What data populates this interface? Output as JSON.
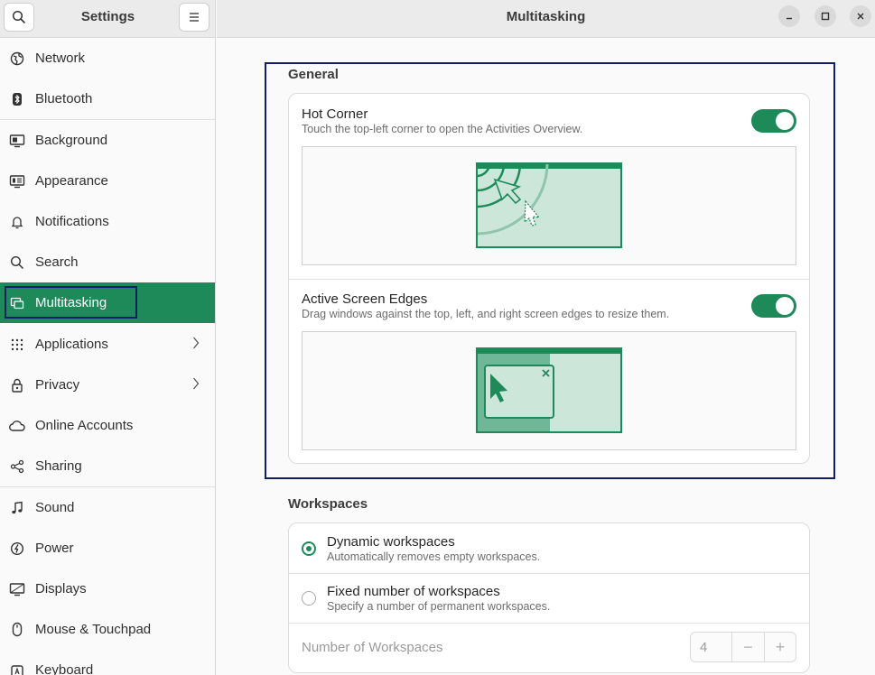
{
  "sidebar": {
    "title": "Settings",
    "items": [
      {
        "label": "Network",
        "icon": "network-icon"
      },
      {
        "label": "Bluetooth",
        "icon": "bluetooth-icon"
      },
      {
        "label": "Background",
        "icon": "background-icon"
      },
      {
        "label": "Appearance",
        "icon": "appearance-icon"
      },
      {
        "label": "Notifications",
        "icon": "bell-icon"
      },
      {
        "label": "Search",
        "icon": "search-icon"
      },
      {
        "label": "Multitasking",
        "icon": "multitasking-icon",
        "active": true
      },
      {
        "label": "Applications",
        "icon": "apps-grid-icon",
        "chevron": true
      },
      {
        "label": "Privacy",
        "icon": "lock-icon",
        "chevron": true
      },
      {
        "label": "Online Accounts",
        "icon": "cloud-icon"
      },
      {
        "label": "Sharing",
        "icon": "share-icon"
      },
      {
        "label": "Sound",
        "icon": "music-note-icon"
      },
      {
        "label": "Power",
        "icon": "power-icon"
      },
      {
        "label": "Displays",
        "icon": "display-icon"
      },
      {
        "label": "Mouse & Touchpad",
        "icon": "mouse-icon"
      },
      {
        "label": "Keyboard",
        "icon": "keyboard-icon"
      }
    ]
  },
  "header": {
    "title": "Multitasking"
  },
  "general": {
    "title": "General",
    "hot_corner": {
      "title": "Hot Corner",
      "subtitle": "Touch the top-left corner to open the Activities Overview.",
      "enabled": true
    },
    "active_edges": {
      "title": "Active Screen Edges",
      "subtitle": "Drag windows against the top, left, and right screen edges to resize them.",
      "enabled": true
    }
  },
  "workspaces": {
    "title": "Workspaces",
    "dynamic": {
      "title": "Dynamic workspaces",
      "subtitle": "Automatically removes empty workspaces.",
      "selected": true
    },
    "fixed": {
      "title": "Fixed number of workspaces",
      "subtitle": "Specify a number of permanent workspaces.",
      "selected": false
    },
    "number": {
      "label": "Number of Workspaces",
      "value": "4",
      "minus": "−",
      "plus": "+"
    }
  },
  "colors": {
    "accent": "#1e8a5a",
    "highlight": "#0f1d6b",
    "preview_fill": "#cde6da"
  }
}
